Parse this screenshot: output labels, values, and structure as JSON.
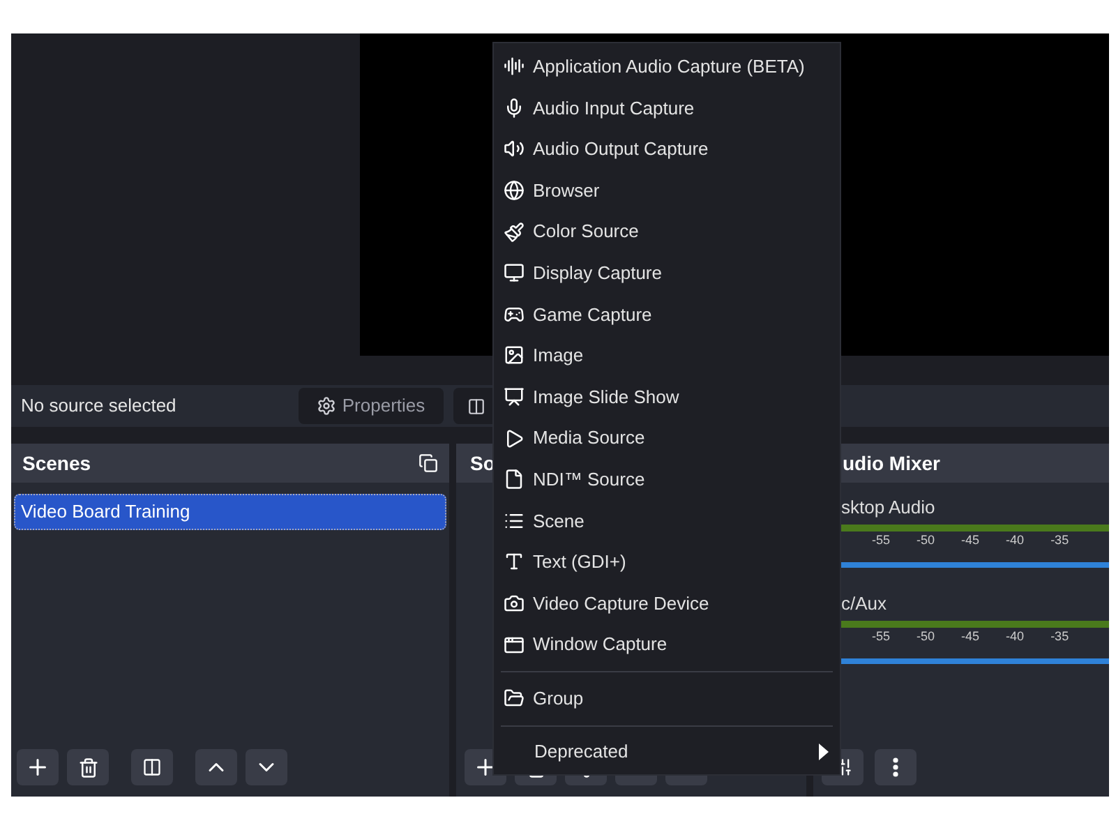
{
  "context_bar": {
    "status": "No source selected",
    "properties_button": "Properties"
  },
  "scenes": {
    "title": "Scenes",
    "items": [
      {
        "label": "Video Board Training",
        "selected": true
      }
    ]
  },
  "sources": {
    "title": "So"
  },
  "audio_mixer": {
    "title": "udio Mixer",
    "channels": [
      {
        "name": "sktop Audio",
        "ticks": [
          "-55",
          "-50",
          "-45",
          "-40",
          "-35"
        ],
        "level": 1
      },
      {
        "name": "c/Aux",
        "ticks": [
          "-55",
          "-50",
          "-45",
          "-40",
          "-35"
        ],
        "level": 1
      }
    ]
  },
  "add_source_menu": {
    "items": [
      {
        "label": "Application Audio Capture (BETA)",
        "kind": "source"
      },
      {
        "label": "Audio Input Capture",
        "kind": "source"
      },
      {
        "label": "Audio Output Capture",
        "kind": "source"
      },
      {
        "label": "Browser",
        "kind": "source"
      },
      {
        "label": "Color Source",
        "kind": "source"
      },
      {
        "label": "Display Capture",
        "kind": "source"
      },
      {
        "label": "Game Capture",
        "kind": "source"
      },
      {
        "label": "Image",
        "kind": "source"
      },
      {
        "label": "Image Slide Show",
        "kind": "source"
      },
      {
        "label": "Media Source",
        "kind": "source"
      },
      {
        "label": "NDI™ Source",
        "kind": "source"
      },
      {
        "label": "Scene",
        "kind": "source"
      },
      {
        "label": "Text (GDI+)",
        "kind": "source"
      },
      {
        "label": "Video Capture Device",
        "kind": "source"
      },
      {
        "label": "Window Capture",
        "kind": "source"
      },
      {
        "label": "Group",
        "kind": "group"
      },
      {
        "label": "Deprecated",
        "kind": "submenu"
      }
    ]
  }
}
